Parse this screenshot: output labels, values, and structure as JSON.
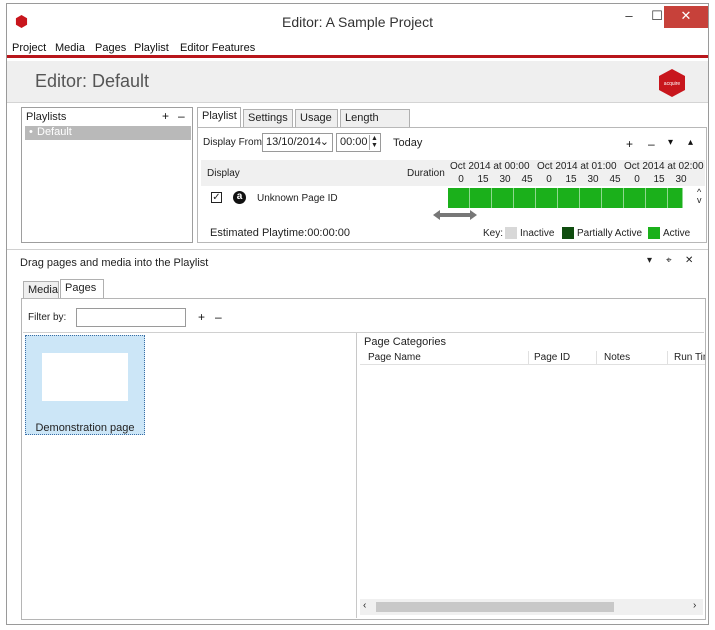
{
  "window": {
    "title": "Editor: A Sample Project",
    "minimize": "–",
    "maximize": "☐",
    "close": "✕"
  },
  "menu": [
    "Project",
    "Media",
    "Pages",
    "Playlist",
    "Editor Features"
  ],
  "header": {
    "title": "Editor: Default",
    "logo_text": "acquire"
  },
  "playlists": {
    "title": "Playlists",
    "add": "+",
    "remove": "–",
    "items": [
      "Default"
    ]
  },
  "playlist_tabs": [
    "Playlist",
    "Settings",
    "Usage",
    "Length Rules"
  ],
  "display_from": {
    "label": "Display From:",
    "date": "13/10/2014",
    "time": "00:00",
    "today": "Today",
    "controls": [
      "+",
      "–",
      "▾",
      "▴"
    ]
  },
  "timeline": {
    "col_display": "Display",
    "col_duration": "Duration",
    "hours": [
      "Oct 2014 at 00:00",
      "Oct 2014 at 01:00",
      "Oct 2014 at 02:00"
    ],
    "minutes": [
      "0",
      "15",
      "30",
      "45",
      "0",
      "15",
      "30",
      "45",
      "0",
      "15",
      "30"
    ],
    "row": {
      "badge": "a",
      "name": "Unknown Page ID",
      "checked": true,
      "state": "Active"
    }
  },
  "estimated": "Estimated Playtime:00:00:00",
  "key": {
    "label": "Key:",
    "items": [
      {
        "name": "Inactive",
        "color": "#d8d8d8"
      },
      {
        "name": "Partially Active",
        "color": "#0f4d0f"
      },
      {
        "name": "Active",
        "color": "#1bb01b"
      }
    ]
  },
  "drag_panel": {
    "title": "Drag pages and media into the Playlist",
    "controls": [
      "▾",
      "⌖",
      "✕"
    ],
    "tabs": [
      "Media",
      "Pages"
    ],
    "filter_label": "Filter by:",
    "filter_value": "",
    "add": "+",
    "remove": "–",
    "tiles": [
      "Demonstration page"
    ]
  },
  "categories": {
    "title": "Page Categories",
    "columns": [
      "Page Name",
      "Page ID",
      "Notes",
      "Run Tim"
    ]
  },
  "colors": {
    "accent": "#b8161b",
    "active": "#1bb01b",
    "close": "#c7413a"
  }
}
